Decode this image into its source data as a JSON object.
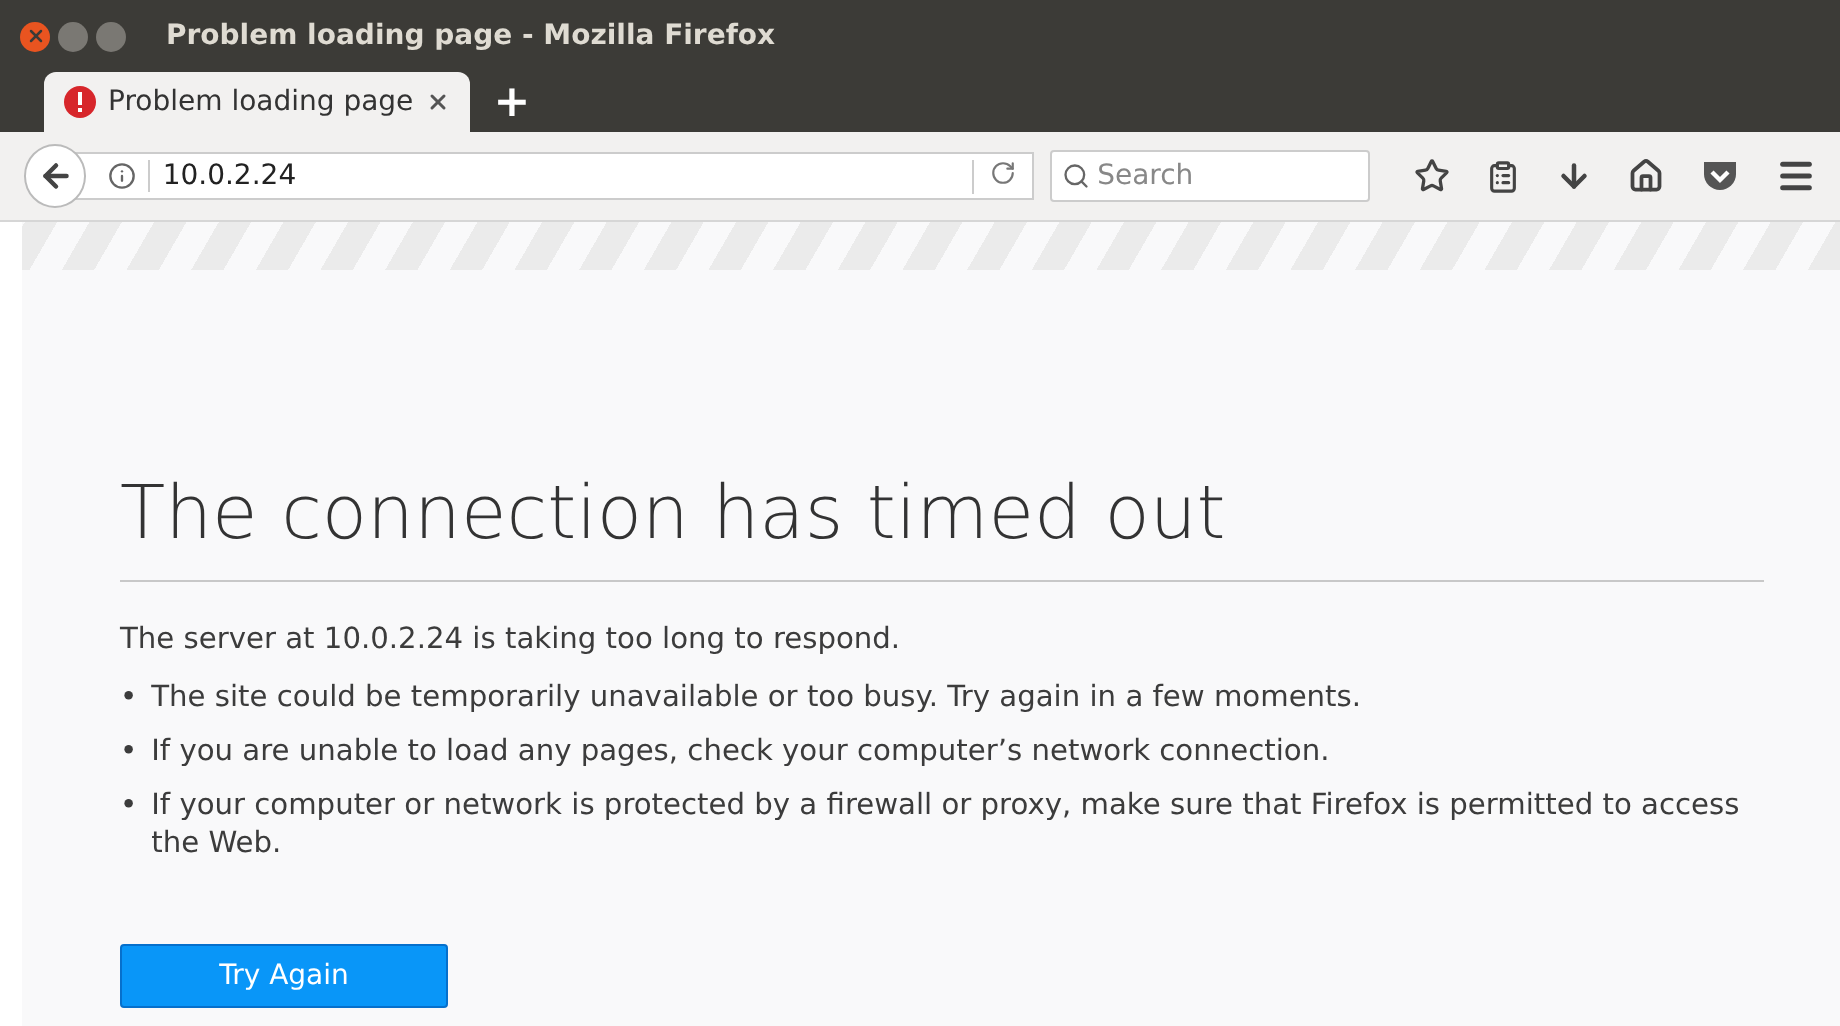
{
  "window": {
    "title": "Problem loading page - Mozilla Firefox"
  },
  "tabs": [
    {
      "label": "Problem loading page",
      "selected": true
    }
  ],
  "new_tab": "+",
  "address_bar": {
    "value": "10.0.2.24"
  },
  "search": {
    "placeholder": "Search"
  },
  "error": {
    "heading": "The connection has timed out",
    "summary": "The server at 10.0.2.24 is taking too long to respond.",
    "bullet": "•",
    "bullets": [
      "The site could be temporarily unavailable or too busy. Try again in a few moments.",
      "If you are unable to load any pages, check your computer’s network connection.",
      "If your computer or network is protected by a firewall or proxy, make sure that Firefox is permitted to access the Web."
    ],
    "button": "Try Again"
  }
}
